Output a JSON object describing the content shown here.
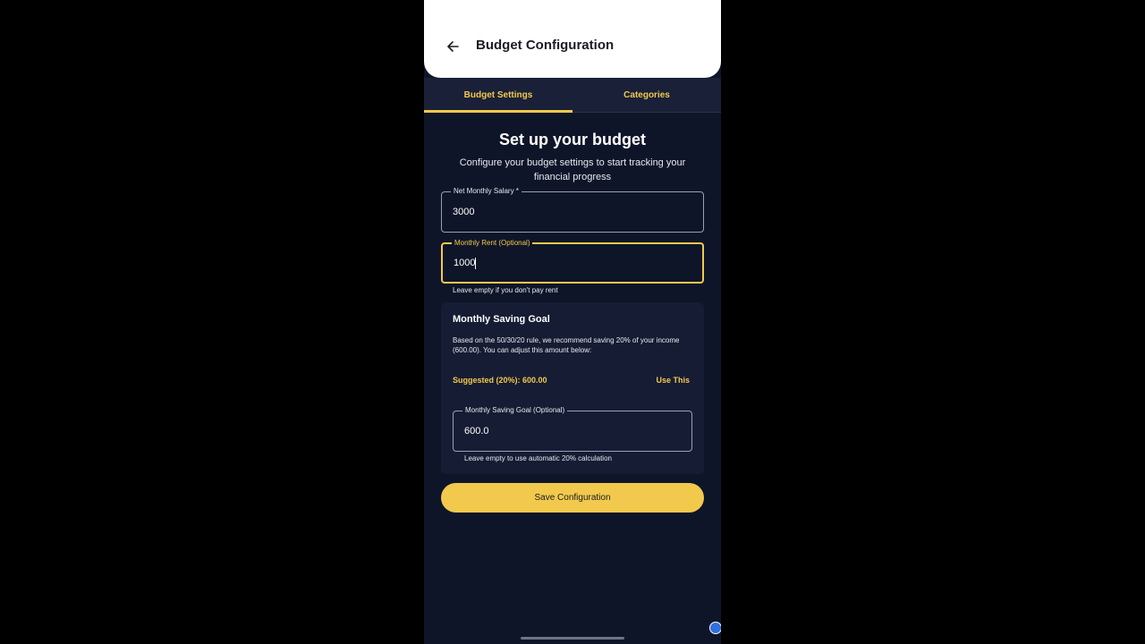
{
  "appbar": {
    "title": "Budget Configuration",
    "back_icon": "arrow-left-icon"
  },
  "tabs": [
    {
      "label": "Budget Settings",
      "active": true
    },
    {
      "label": "Categories",
      "active": false
    }
  ],
  "main": {
    "heading": "Set up your budget",
    "subheading": "Configure your budget settings to start tracking your financial progress"
  },
  "salary": {
    "label": "Net Monthly Salary *",
    "value": "3000"
  },
  "rent": {
    "label": "Monthly Rent (Optional)",
    "value": "1000",
    "helper": "Leave empty if you don't pay rent"
  },
  "saving_card": {
    "title": "Monthly Saving Goal",
    "description": "Based on the 50/30/20 rule, we recommend saving 20% of your income (600.00). You can adjust this amount below:",
    "suggested": "Suggested (20%): 600.00",
    "use_this": "Use This",
    "goal_label": "Monthly Saving Goal (Optional)",
    "goal_value": "600.0",
    "goal_helper": "Leave empty to use automatic 20% calculation"
  },
  "save_button": "Save Configuration",
  "colors": {
    "accent": "#f2c94c",
    "background": "#0f1529",
    "surface": "#161c33",
    "appbar": "#ffffff"
  }
}
